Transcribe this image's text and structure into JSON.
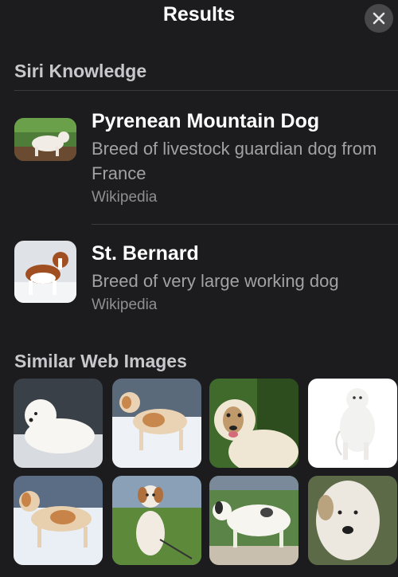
{
  "header": {
    "title": "Results"
  },
  "siri_knowledge": {
    "heading": "Siri Knowledge",
    "results": [
      {
        "title": "Pyrenean Mountain Dog",
        "description": "Breed of livestock guardian dog from France",
        "source": "Wikipedia"
      },
      {
        "title": "St. Bernard",
        "description": "Breed of very large working dog",
        "source": "Wikipedia"
      }
    ]
  },
  "similar_images": {
    "heading": "Similar Web Images"
  },
  "icons": {
    "close": "close-icon"
  },
  "colors": {
    "background": "#1c1c1e",
    "secondary_text": "#a1a1a6",
    "tertiary_text": "#8e8e93",
    "close_button": "#48484a"
  }
}
